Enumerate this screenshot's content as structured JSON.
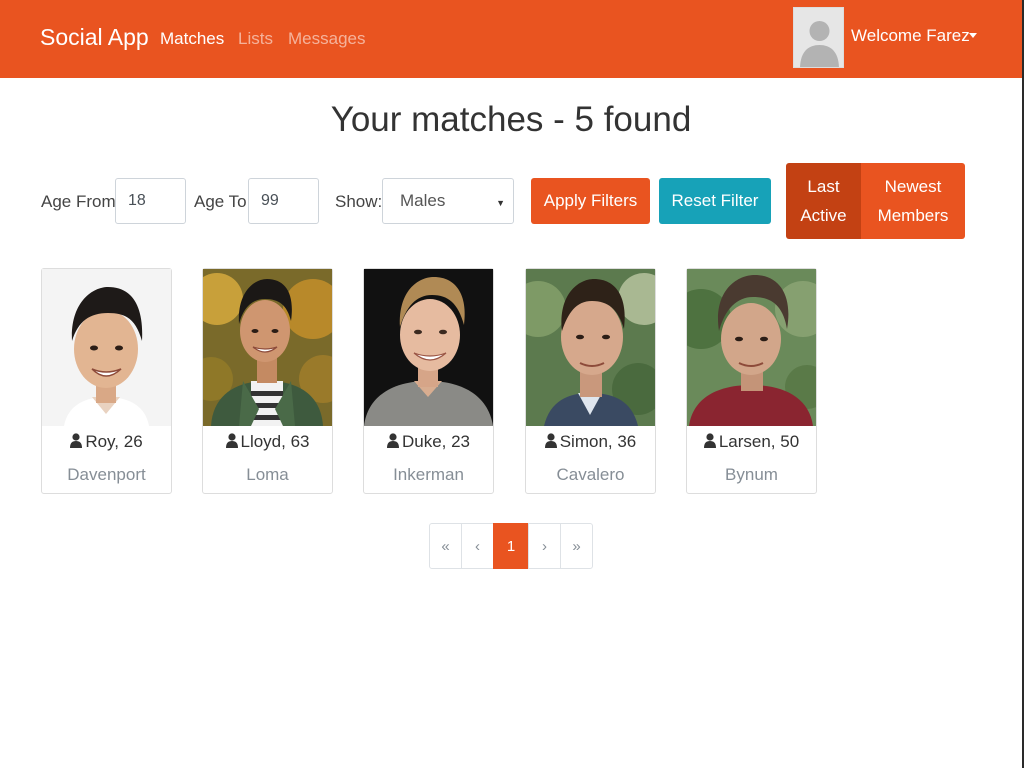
{
  "navbar": {
    "brand": "Social App",
    "links": [
      {
        "label": "Matches",
        "active": true
      },
      {
        "label": "Lists",
        "active": false
      },
      {
        "label": "Messages",
        "active": false
      }
    ],
    "welcome": "Welcome Farez",
    "accent": "#e95420"
  },
  "page": {
    "title": "Your matches - 5 found"
  },
  "filters": {
    "age_from_label": "Age From",
    "age_from_value": "18",
    "age_to_label": "Age To",
    "age_to_value": "99",
    "show_label": "Show:",
    "show_value": "Males",
    "apply_label": "Apply Filters",
    "reset_label": "Reset Filter",
    "sort": {
      "last_active_line1": "Last",
      "last_active_line2": "Active",
      "newest_line1": "Newest",
      "newest_line2": "Members"
    }
  },
  "members": [
    {
      "name_age": "Roy, 26",
      "city": "Davenport",
      "icon": "user-icon"
    },
    {
      "name_age": "Lloyd, 63",
      "city": "Loma",
      "icon": "user-icon"
    },
    {
      "name_age": "Duke, 23",
      "city": "Inkerman",
      "icon": "user-icon"
    },
    {
      "name_age": "Simon, 36",
      "city": "Cavalero",
      "icon": "user-icon"
    },
    {
      "name_age": "Larsen, 50",
      "city": "Bynum",
      "icon": "user-icon"
    }
  ],
  "pagination": {
    "first": "«",
    "prev": "‹",
    "current": "1",
    "next": "›",
    "last": "»"
  }
}
